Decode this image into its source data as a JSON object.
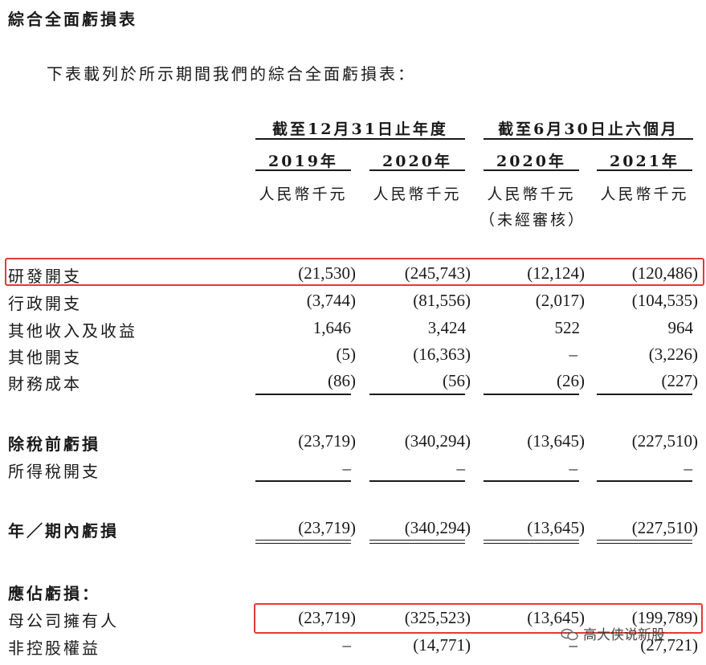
{
  "title": "綜合全面虧損表",
  "intro": "下表載列於所示期間我們的綜合全面虧損表：",
  "header": {
    "group1": "截至12月31日止年度",
    "group2": "截至6月30日止六個月",
    "years": [
      "2019年",
      "2020年",
      "2020年",
      "2021年"
    ],
    "unit": "人民幣千元",
    "unaudited": "（未經審核）"
  },
  "rows": [
    {
      "label": "研發開支",
      "values": [
        "(21,530)",
        "(245,743)",
        "(12,124)",
        "(120,486)"
      ],
      "bold": false
    },
    {
      "label": "行政開支",
      "values": [
        "(3,744)",
        "(81,556)",
        "(2,017)",
        "(104,535)"
      ],
      "bold": false
    },
    {
      "label": "其他收入及收益",
      "values": [
        "1,646",
        "3,424",
        "522",
        "964"
      ],
      "bold": false
    },
    {
      "label": "其他開支",
      "values": [
        "(5)",
        "(16,363)",
        "–",
        "(3,226)"
      ],
      "bold": false
    },
    {
      "label": "財務成本",
      "values": [
        "(86)",
        "(56)",
        "(26)",
        "(227)"
      ],
      "bold": false
    },
    {
      "label": "除稅前虧損",
      "values": [
        "(23,719)",
        "(340,294)",
        "(13,645)",
        "(227,510)"
      ],
      "bold": true
    },
    {
      "label": "所得稅開支",
      "values": [
        "–",
        "–",
        "–",
        "–"
      ],
      "bold": false
    },
    {
      "label": "年／期內虧損",
      "values": [
        "(23,719)",
        "(340,294)",
        "(13,645)",
        "(227,510)"
      ],
      "bold": true
    },
    {
      "label": "應佔虧損：",
      "values": [
        "",
        "",
        "",
        ""
      ],
      "bold": true
    },
    {
      "label": "母公司擁有人",
      "values": [
        "(23,719)",
        "(325,523)",
        "(13,645)",
        "(199,789)"
      ],
      "bold": false
    },
    {
      "label": "非控股權益",
      "values": [
        "–",
        "(14,771)",
        "–",
        "(27,721)"
      ],
      "bold": false
    }
  ],
  "watermark": "高大侠说新股",
  "colors": {
    "highlight": "#e53935",
    "text": "#1a1a1a"
  }
}
